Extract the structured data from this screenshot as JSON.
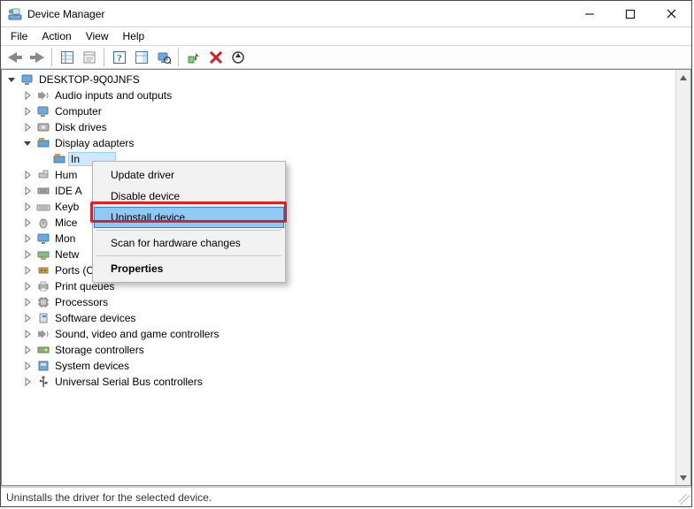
{
  "window": {
    "title": "Device Manager"
  },
  "menubar": [
    "File",
    "Action",
    "View",
    "Help"
  ],
  "tree": {
    "root": "DESKTOP-9Q0JNFS",
    "items": [
      {
        "label": "Audio inputs and outputs",
        "expanded": false
      },
      {
        "label": "Computer",
        "expanded": false
      },
      {
        "label": "Disk drives",
        "expanded": false
      },
      {
        "label": "Display adapters",
        "expanded": true,
        "children": [
          {
            "label": "In",
            "selected": true
          }
        ]
      },
      {
        "label": "Hum",
        "expanded": false,
        "truncated": true
      },
      {
        "label": "IDE A",
        "expanded": false,
        "truncated": true
      },
      {
        "label": "Keyb",
        "expanded": false,
        "truncated": true
      },
      {
        "label": "Mice",
        "expanded": false,
        "truncated": true
      },
      {
        "label": "Mon",
        "expanded": false,
        "truncated": true
      },
      {
        "label": "Netw",
        "expanded": false,
        "truncated": true
      },
      {
        "label": "Ports (COM & LPT)",
        "expanded": false
      },
      {
        "label": "Print queues",
        "expanded": false
      },
      {
        "label": "Processors",
        "expanded": false
      },
      {
        "label": "Software devices",
        "expanded": false
      },
      {
        "label": "Sound, video and game controllers",
        "expanded": false
      },
      {
        "label": "Storage controllers",
        "expanded": false
      },
      {
        "label": "System devices",
        "expanded": false
      },
      {
        "label": "Universal Serial Bus controllers",
        "expanded": false
      }
    ]
  },
  "context_menu": {
    "items": [
      {
        "label": "Update driver"
      },
      {
        "label": "Disable device"
      },
      {
        "label": "Uninstall device",
        "selected": true
      },
      {
        "type": "sep"
      },
      {
        "label": "Scan for hardware changes"
      },
      {
        "type": "sep"
      },
      {
        "label": "Properties",
        "bold": true
      }
    ]
  },
  "statusbar": {
    "text": "Uninstalls the driver for the selected device."
  }
}
